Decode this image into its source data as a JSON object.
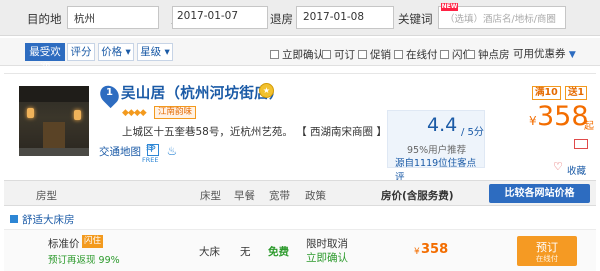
{
  "search": {
    "destination_label": "目的地",
    "destination_value": "杭州",
    "checkin_label": "入住",
    "checkin_value": "2017-01-07",
    "checkout_label": "退房",
    "checkout_value": "2017-01-08",
    "keyword_label": "关键词",
    "keyword_placeholder": "（选填）酒店名/地标/商圈",
    "new_badge": "NEW"
  },
  "filters": {
    "sort_tabs": [
      "最受欢迎",
      "评分",
      "价格 ▾",
      "星级 ▾"
    ],
    "checkboxes": [
      "立即确认",
      "可订",
      "促销",
      "在线付",
      "闪住",
      "钟点房"
    ],
    "coupon_label": "可用优惠券",
    "coupon_caret": "▼"
  },
  "hotel": {
    "index": "1",
    "name": "吴山居（杭州河坊街店）",
    "medal": "★",
    "diamonds": "◆◆◆◆",
    "chain_tag": "江南韵味",
    "address": "上城区十五奎巷58号，近杭州艺苑。",
    "area_link": "【 西湖南宋商圈 】",
    "map_link": "交通地图",
    "icons": {
      "parking": "P",
      "wifi": "FREE",
      "wifi_symbol": "≋"
    },
    "score": "4.4",
    "score_den": "/ 5分",
    "recommend": "95%用户推荐",
    "reviews": "源自1119位住客点评",
    "promo_man": "满10",
    "promo_jian": "送1",
    "price_currency": "¥",
    "price": "358",
    "price_suffix": "起",
    "favorite": "收藏",
    "heart": "♡"
  },
  "table": {
    "headers": {
      "room": "房型",
      "bed": "床型",
      "breakfast": "早餐",
      "wifi": "宽带",
      "policy": "政策",
      "price": "房价(含服务费)"
    },
    "compare_button": "比较各网站价格",
    "room_type": "舒适大床房",
    "rate": {
      "name": "标准价",
      "flash": "闪住",
      "sub": "预订再返现 99%",
      "bed": "大床",
      "breakfast": "无",
      "wifi": "免费",
      "policy_line1": "限时取消",
      "policy_line2": "立即确认",
      "price_currency": "¥",
      "price": "358",
      "book_label": "预订",
      "book_sub": "在线付"
    }
  }
}
